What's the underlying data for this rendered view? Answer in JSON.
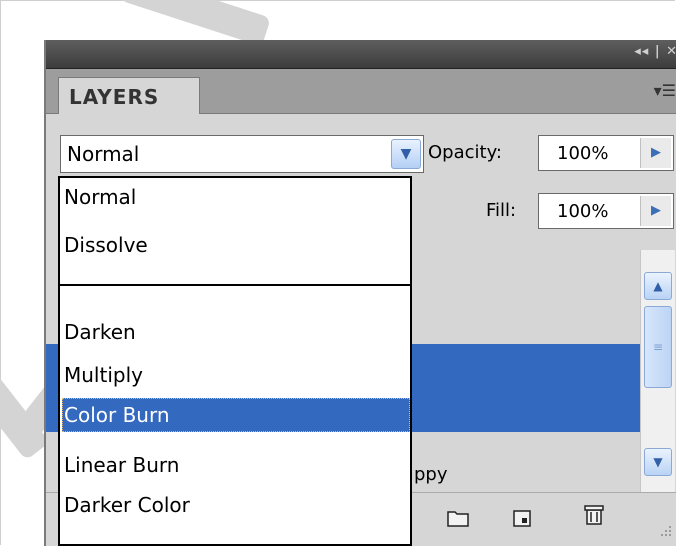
{
  "panel": {
    "title_controls": "◂◂ | ✕",
    "tab_label": "LAYERS",
    "menu_icon": "panel-menu-icon"
  },
  "blend_mode": {
    "selected": "Normal",
    "options": [
      "Normal",
      "Dissolve",
      "Darken",
      "Multiply",
      "Color Burn",
      "Linear Burn",
      "Darker Color"
    ],
    "highlighted": "Color Burn"
  },
  "opacity": {
    "label": "Opacity:",
    "value": "100%"
  },
  "fill": {
    "label": "Fill:",
    "value": "100%"
  },
  "layers": {
    "partial_name": "ppy"
  },
  "colors": {
    "accent": "#3469c0",
    "panel_bg": "#d6d6d6"
  }
}
